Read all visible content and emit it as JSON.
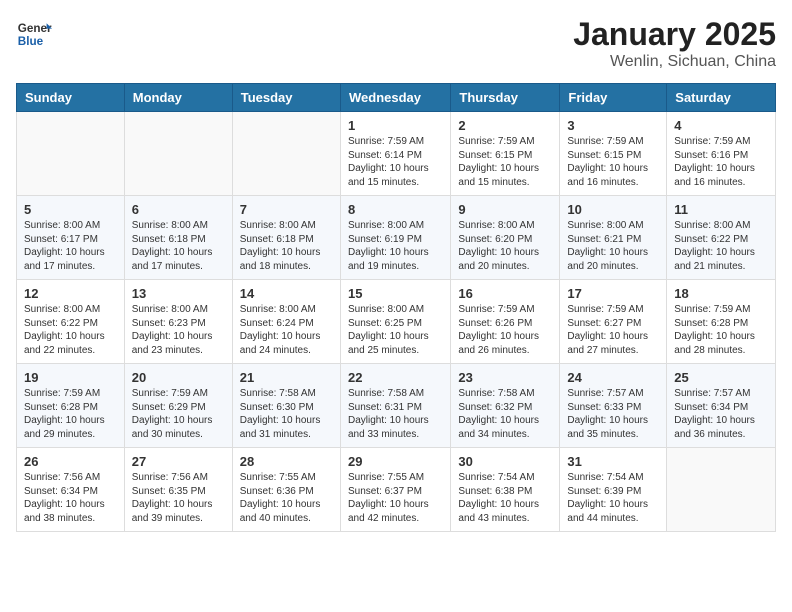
{
  "header": {
    "logo_line1": "General",
    "logo_line2": "Blue",
    "month": "January 2025",
    "location": "Wenlin, Sichuan, China"
  },
  "days_of_week": [
    "Sunday",
    "Monday",
    "Tuesday",
    "Wednesday",
    "Thursday",
    "Friday",
    "Saturday"
  ],
  "weeks": [
    [
      {
        "day": "",
        "sunrise": "",
        "sunset": "",
        "daylight": "",
        "empty": true
      },
      {
        "day": "",
        "sunrise": "",
        "sunset": "",
        "daylight": "",
        "empty": true
      },
      {
        "day": "",
        "sunrise": "",
        "sunset": "",
        "daylight": "",
        "empty": true
      },
      {
        "day": "1",
        "sunrise": "Sunrise: 7:59 AM",
        "sunset": "Sunset: 6:14 PM",
        "daylight": "Daylight: 10 hours and 15 minutes.",
        "empty": false
      },
      {
        "day": "2",
        "sunrise": "Sunrise: 7:59 AM",
        "sunset": "Sunset: 6:15 PM",
        "daylight": "Daylight: 10 hours and 15 minutes.",
        "empty": false
      },
      {
        "day": "3",
        "sunrise": "Sunrise: 7:59 AM",
        "sunset": "Sunset: 6:15 PM",
        "daylight": "Daylight: 10 hours and 16 minutes.",
        "empty": false
      },
      {
        "day": "4",
        "sunrise": "Sunrise: 7:59 AM",
        "sunset": "Sunset: 6:16 PM",
        "daylight": "Daylight: 10 hours and 16 minutes.",
        "empty": false
      }
    ],
    [
      {
        "day": "5",
        "sunrise": "Sunrise: 8:00 AM",
        "sunset": "Sunset: 6:17 PM",
        "daylight": "Daylight: 10 hours and 17 minutes.",
        "empty": false
      },
      {
        "day": "6",
        "sunrise": "Sunrise: 8:00 AM",
        "sunset": "Sunset: 6:18 PM",
        "daylight": "Daylight: 10 hours and 17 minutes.",
        "empty": false
      },
      {
        "day": "7",
        "sunrise": "Sunrise: 8:00 AM",
        "sunset": "Sunset: 6:18 PM",
        "daylight": "Daylight: 10 hours and 18 minutes.",
        "empty": false
      },
      {
        "day": "8",
        "sunrise": "Sunrise: 8:00 AM",
        "sunset": "Sunset: 6:19 PM",
        "daylight": "Daylight: 10 hours and 19 minutes.",
        "empty": false
      },
      {
        "day": "9",
        "sunrise": "Sunrise: 8:00 AM",
        "sunset": "Sunset: 6:20 PM",
        "daylight": "Daylight: 10 hours and 20 minutes.",
        "empty": false
      },
      {
        "day": "10",
        "sunrise": "Sunrise: 8:00 AM",
        "sunset": "Sunset: 6:21 PM",
        "daylight": "Daylight: 10 hours and 20 minutes.",
        "empty": false
      },
      {
        "day": "11",
        "sunrise": "Sunrise: 8:00 AM",
        "sunset": "Sunset: 6:22 PM",
        "daylight": "Daylight: 10 hours and 21 minutes.",
        "empty": false
      }
    ],
    [
      {
        "day": "12",
        "sunrise": "Sunrise: 8:00 AM",
        "sunset": "Sunset: 6:22 PM",
        "daylight": "Daylight: 10 hours and 22 minutes.",
        "empty": false
      },
      {
        "day": "13",
        "sunrise": "Sunrise: 8:00 AM",
        "sunset": "Sunset: 6:23 PM",
        "daylight": "Daylight: 10 hours and 23 minutes.",
        "empty": false
      },
      {
        "day": "14",
        "sunrise": "Sunrise: 8:00 AM",
        "sunset": "Sunset: 6:24 PM",
        "daylight": "Daylight: 10 hours and 24 minutes.",
        "empty": false
      },
      {
        "day": "15",
        "sunrise": "Sunrise: 8:00 AM",
        "sunset": "Sunset: 6:25 PM",
        "daylight": "Daylight: 10 hours and 25 minutes.",
        "empty": false
      },
      {
        "day": "16",
        "sunrise": "Sunrise: 7:59 AM",
        "sunset": "Sunset: 6:26 PM",
        "daylight": "Daylight: 10 hours and 26 minutes.",
        "empty": false
      },
      {
        "day": "17",
        "sunrise": "Sunrise: 7:59 AM",
        "sunset": "Sunset: 6:27 PM",
        "daylight": "Daylight: 10 hours and 27 minutes.",
        "empty": false
      },
      {
        "day": "18",
        "sunrise": "Sunrise: 7:59 AM",
        "sunset": "Sunset: 6:28 PM",
        "daylight": "Daylight: 10 hours and 28 minutes.",
        "empty": false
      }
    ],
    [
      {
        "day": "19",
        "sunrise": "Sunrise: 7:59 AM",
        "sunset": "Sunset: 6:28 PM",
        "daylight": "Daylight: 10 hours and 29 minutes.",
        "empty": false
      },
      {
        "day": "20",
        "sunrise": "Sunrise: 7:59 AM",
        "sunset": "Sunset: 6:29 PM",
        "daylight": "Daylight: 10 hours and 30 minutes.",
        "empty": false
      },
      {
        "day": "21",
        "sunrise": "Sunrise: 7:58 AM",
        "sunset": "Sunset: 6:30 PM",
        "daylight": "Daylight: 10 hours and 31 minutes.",
        "empty": false
      },
      {
        "day": "22",
        "sunrise": "Sunrise: 7:58 AM",
        "sunset": "Sunset: 6:31 PM",
        "daylight": "Daylight: 10 hours and 33 minutes.",
        "empty": false
      },
      {
        "day": "23",
        "sunrise": "Sunrise: 7:58 AM",
        "sunset": "Sunset: 6:32 PM",
        "daylight": "Daylight: 10 hours and 34 minutes.",
        "empty": false
      },
      {
        "day": "24",
        "sunrise": "Sunrise: 7:57 AM",
        "sunset": "Sunset: 6:33 PM",
        "daylight": "Daylight: 10 hours and 35 minutes.",
        "empty": false
      },
      {
        "day": "25",
        "sunrise": "Sunrise: 7:57 AM",
        "sunset": "Sunset: 6:34 PM",
        "daylight": "Daylight: 10 hours and 36 minutes.",
        "empty": false
      }
    ],
    [
      {
        "day": "26",
        "sunrise": "Sunrise: 7:56 AM",
        "sunset": "Sunset: 6:34 PM",
        "daylight": "Daylight: 10 hours and 38 minutes.",
        "empty": false
      },
      {
        "day": "27",
        "sunrise": "Sunrise: 7:56 AM",
        "sunset": "Sunset: 6:35 PM",
        "daylight": "Daylight: 10 hours and 39 minutes.",
        "empty": false
      },
      {
        "day": "28",
        "sunrise": "Sunrise: 7:55 AM",
        "sunset": "Sunset: 6:36 PM",
        "daylight": "Daylight: 10 hours and 40 minutes.",
        "empty": false
      },
      {
        "day": "29",
        "sunrise": "Sunrise: 7:55 AM",
        "sunset": "Sunset: 6:37 PM",
        "daylight": "Daylight: 10 hours and 42 minutes.",
        "empty": false
      },
      {
        "day": "30",
        "sunrise": "Sunrise: 7:54 AM",
        "sunset": "Sunset: 6:38 PM",
        "daylight": "Daylight: 10 hours and 43 minutes.",
        "empty": false
      },
      {
        "day": "31",
        "sunrise": "Sunrise: 7:54 AM",
        "sunset": "Sunset: 6:39 PM",
        "daylight": "Daylight: 10 hours and 44 minutes.",
        "empty": false
      },
      {
        "day": "",
        "sunrise": "",
        "sunset": "",
        "daylight": "",
        "empty": true
      }
    ]
  ]
}
